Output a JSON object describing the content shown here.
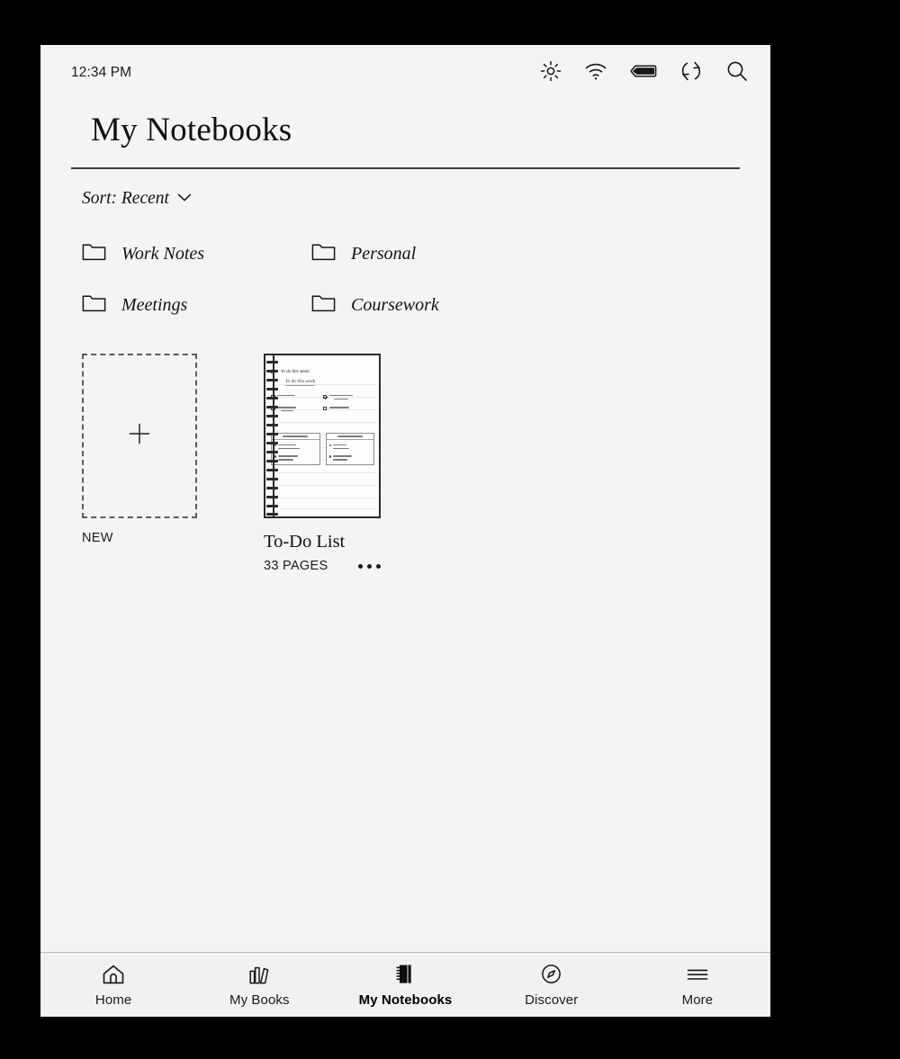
{
  "status_bar": {
    "clock": "12:34 PM",
    "icons": [
      {
        "name": "brightness-icon",
        "label": "Brightness"
      },
      {
        "name": "wifi-icon",
        "label": "Wi-Fi"
      },
      {
        "name": "battery-icon",
        "label": "Battery"
      },
      {
        "name": "sync-icon",
        "label": "Sync"
      },
      {
        "name": "search-icon",
        "label": "Search"
      }
    ]
  },
  "header": {
    "title": "My Notebooks"
  },
  "sort": {
    "label": "Sort: Recent",
    "chevron": "chevron-down-icon"
  },
  "folders": [
    {
      "label": "Work Notes"
    },
    {
      "label": "Personal"
    },
    {
      "label": "Meetings"
    },
    {
      "label": "Coursework"
    }
  ],
  "new_card": {
    "label": "NEW",
    "plus": "plus-icon"
  },
  "notebook": {
    "title": "To-Do List",
    "pages": "33 PAGES",
    "more": "more-options-icon",
    "preview": {
      "back": "back-arrow-icon",
      "header_text": "To do this week",
      "doc_title": "To do this week",
      "checklist": [
        {
          "checked": true,
          "lines": 1
        },
        {
          "checked": true,
          "lines": 2
        },
        {
          "checked": false,
          "lines": 2
        },
        {
          "checked": false,
          "lines": 1
        }
      ],
      "boxes": [
        {
          "items": [
            2,
            2
          ]
        },
        {
          "items": [
            2,
            2
          ]
        }
      ]
    }
  },
  "bottom_nav": [
    {
      "label": "Home",
      "icon": "home-icon",
      "active": false
    },
    {
      "label": "My Books",
      "icon": "books-icon",
      "active": false
    },
    {
      "label": "My Notebooks",
      "icon": "notebook-icon",
      "active": true
    },
    {
      "label": "Discover",
      "icon": "compass-icon",
      "active": false
    },
    {
      "label": "More",
      "icon": "hamburger-icon",
      "active": false
    }
  ],
  "colors": {
    "screen_bg": "#f4f4f2",
    "bezel": "#000000",
    "text": "#111111",
    "rule": "#3c3c3c"
  }
}
